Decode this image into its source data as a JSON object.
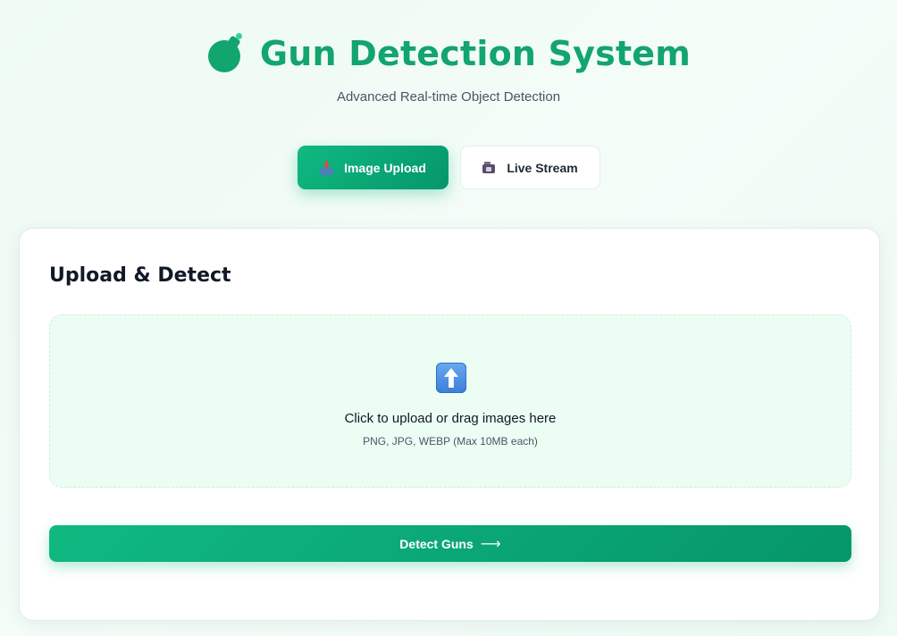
{
  "header": {
    "title": "Gun Detection System",
    "subtitle": "Advanced Real-time Object Detection"
  },
  "tabs": [
    {
      "label": "Image Upload",
      "icon": "inbox-tray-icon",
      "active": true
    },
    {
      "label": "Live Stream",
      "icon": "video-camera-icon",
      "active": false
    }
  ],
  "upload": {
    "heading": "Upload & Detect",
    "drop_text": "Click to upload or drag images here",
    "formats_text": "PNG, JPG, WEBP (Max 10MB each)",
    "icon": "upload-arrow-icon"
  },
  "action": {
    "detect_label": "Detect Guns",
    "arrow": "⟶"
  },
  "colors": {
    "accent": "#10b981",
    "accent_dark": "#059669",
    "title": "#12a56e",
    "dropzone_bg": "#ecfdf4"
  }
}
